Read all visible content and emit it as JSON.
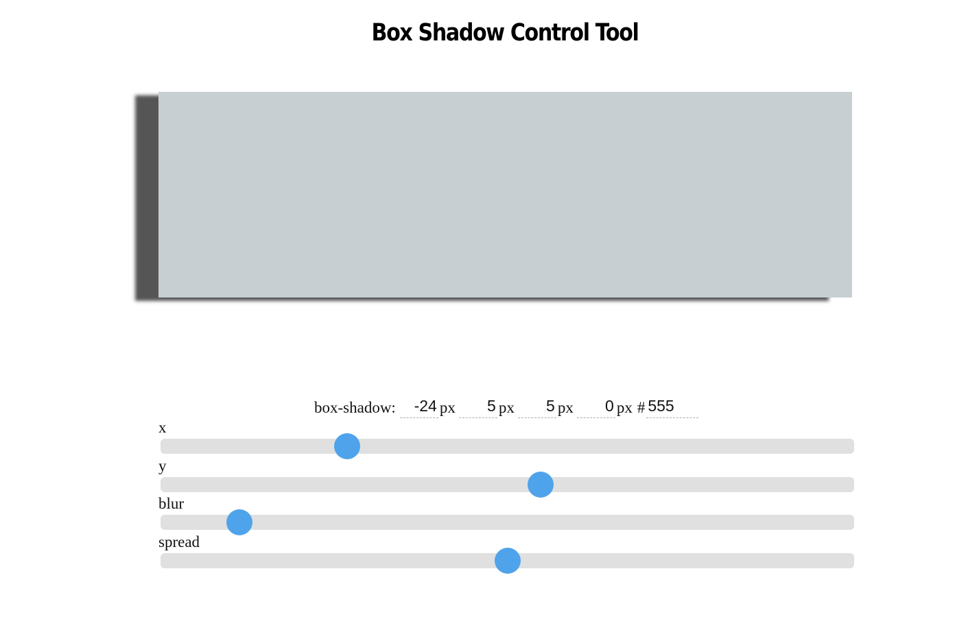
{
  "page": {
    "title": "Box Shadow Control Tool"
  },
  "preview": {
    "box_color": "#c8cfd2",
    "shadow_color": "#555"
  },
  "code": {
    "label": "box-shadow:",
    "x_value": "-24",
    "y_value": "5",
    "blur_value": "5",
    "spread_value": "0",
    "unit": "px",
    "hash": "#",
    "color_value": "555"
  },
  "sliders": {
    "accent_color": "#4fa3ea",
    "track_color": "#e0e0e0",
    "x": {
      "label": "x",
      "level": 0.269
    },
    "y": {
      "label": "y",
      "level": 0.548
    },
    "blur": {
      "label": "blur",
      "level": 0.114
    },
    "spread": {
      "label": "spread",
      "level": 0.5
    }
  }
}
